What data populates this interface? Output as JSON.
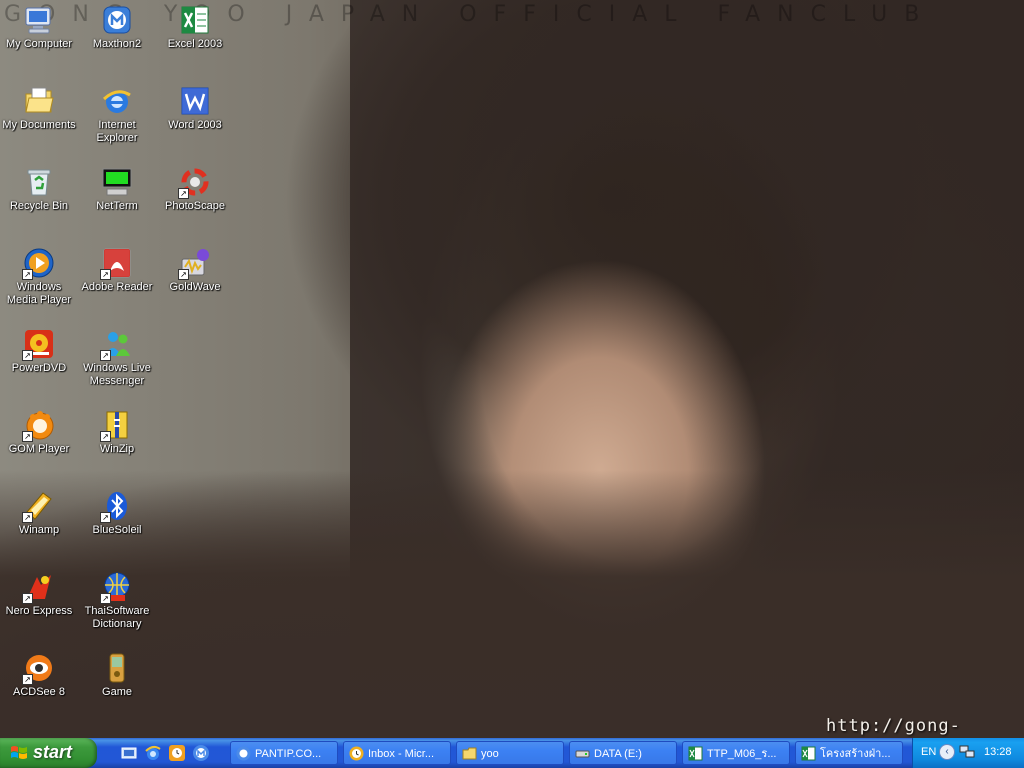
{
  "wallpaper": {
    "banner_text": "GONG YOO JAPAN OFFICIAL FANCLUB",
    "url_text": "http://gong-yoo.jp"
  },
  "desktop_icons": [
    {
      "label": "My Computer",
      "icon": "my-computer-icon"
    },
    {
      "label": "Maxthon2",
      "icon": "maxthon-icon"
    },
    {
      "label": "Excel 2003",
      "icon": "excel-icon"
    },
    {
      "label": "My Documents",
      "icon": "my-documents-icon"
    },
    {
      "label": "Internet Explorer",
      "icon": "internet-explorer-icon"
    },
    {
      "label": "Word 2003",
      "icon": "word-icon"
    },
    {
      "label": "Recycle Bin",
      "icon": "recycle-bin-icon"
    },
    {
      "label": "NetTerm",
      "icon": "netterm-icon"
    },
    {
      "label": "PhotoScape",
      "icon": "photoscape-icon"
    },
    {
      "label": "Windows Media Player",
      "icon": "windows-media-player-icon"
    },
    {
      "label": "Adobe Reader",
      "icon": "adobe-reader-icon"
    },
    {
      "label": "GoldWave",
      "icon": "goldwave-icon"
    },
    {
      "label": "PowerDVD",
      "icon": "powerdvd-icon"
    },
    {
      "label": "Windows Live Messenger",
      "icon": "messenger-icon"
    },
    {
      "label": "GOM Player",
      "icon": "gom-player-icon"
    },
    {
      "label": "WinZip",
      "icon": "winzip-icon"
    },
    {
      "label": "Winamp",
      "icon": "winamp-icon"
    },
    {
      "label": "BlueSoleil",
      "icon": "bluetooth-icon"
    },
    {
      "label": "Nero Express",
      "icon": "nero-icon"
    },
    {
      "label": "ThaiSoftware Dictionary",
      "icon": "dictionary-globe-icon"
    },
    {
      "label": "ACDSee 8",
      "icon": "acdsee-icon"
    },
    {
      "label": "Game",
      "icon": "game-device-icon"
    }
  ],
  "taskbar": {
    "start_label": "start",
    "quick_launch": [
      "show-desktop-icon",
      "internet-explorer-icon",
      "clock-app-icon",
      "maxthon-icon"
    ],
    "tasks": [
      {
        "label": "PANTIP.CO...",
        "icon": "maxthon-icon"
      },
      {
        "label": "Inbox - Micr...",
        "icon": "outlook-icon"
      },
      {
        "label": "yoo",
        "icon": "folder-icon"
      },
      {
        "label": "DATA (E:)",
        "icon": "drive-icon"
      },
      {
        "label": "TTP_M06_ร...",
        "icon": "excel-icon"
      },
      {
        "label": "โครงสร้างฝ่า...",
        "icon": "excel-icon"
      }
    ],
    "tray": {
      "language": "EN",
      "clock": "13:28"
    }
  },
  "colors": {
    "taskbar_blue": "#2257d5",
    "start_green": "#3d9a3d",
    "tray_blue": "#0f8ae0"
  }
}
